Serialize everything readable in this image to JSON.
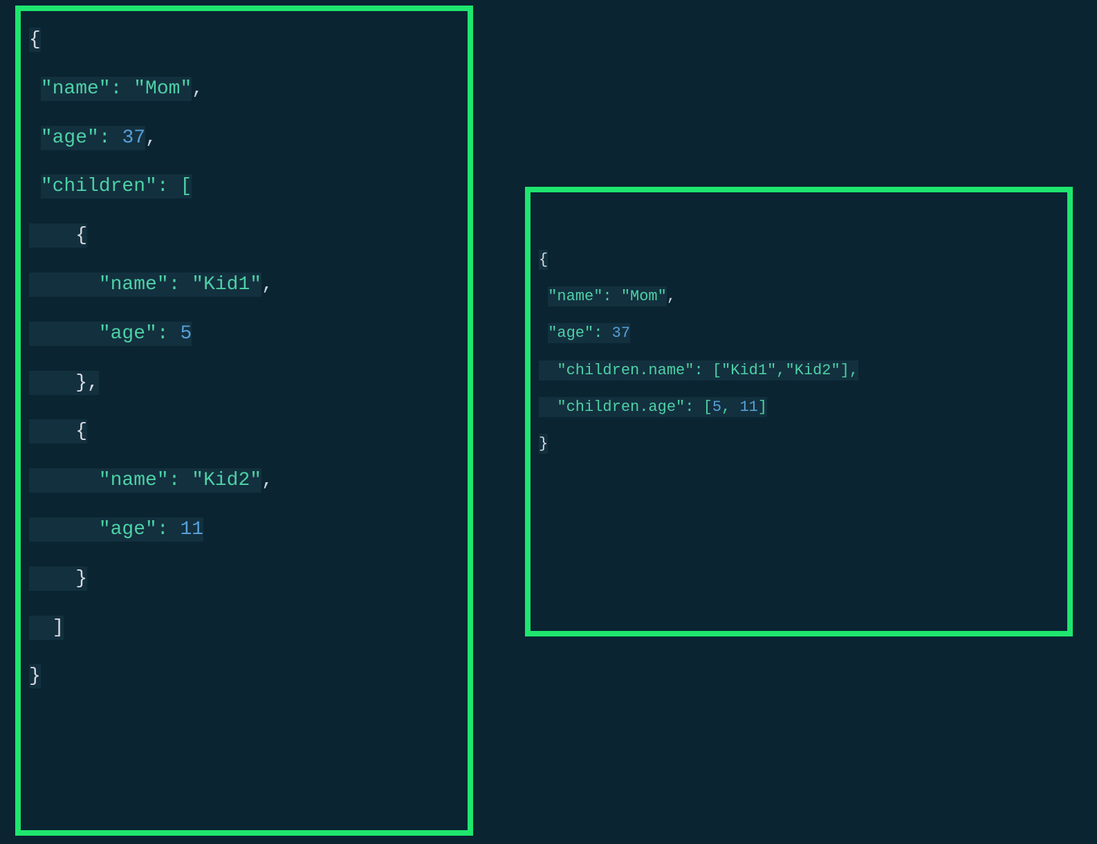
{
  "left": {
    "l1": "{",
    "l2_key": "\"name\"",
    "l2_colon": ": ",
    "l2_val": "\"Mom\"",
    "l2_comma": ",",
    "l3_key": "\"age\"",
    "l3_colon": ": ",
    "l3_val": "37",
    "l3_comma": ",",
    "l4_key": "\"children\"",
    "l4_colon": ": [",
    "l5": "    {",
    "l6_ind": "      ",
    "l6_key": "\"name\"",
    "l6_colon": ": ",
    "l6_val": "\"Kid1\"",
    "l6_comma": ",",
    "l7_ind": "      ",
    "l7_key": "\"age\"",
    "l7_colon": ": ",
    "l7_val": "5",
    "l8": "    },",
    "l9": "    {",
    "l10_ind": "      ",
    "l10_key": "\"name\"",
    "l10_colon": ": ",
    "l10_val": "\"Kid2\"",
    "l10_comma": ",",
    "l11_ind": "      ",
    "l11_key": "\"age\"",
    "l11_colon": ": ",
    "l11_val": "11",
    "l12": "    }",
    "l13": "  ]",
    "l14": "}"
  },
  "right": {
    "l1": "{",
    "l2_key": "\"name\"",
    "l2_colon": ": ",
    "l2_val": "\"Mom\"",
    "l2_comma": ",",
    "l3_key": "\"age\"",
    "l3_colon": ": ",
    "l3_val": "37",
    "l4_ind": "  ",
    "l4_key": "\"children.name\"",
    "l4_colon": ": [",
    "l4_v1": "\"Kid1\"",
    "l4_c1": ",",
    "l4_v2": "\"Kid2\"",
    "l4_close": "],",
    "l5_ind": "  ",
    "l5_key": "\"children.age\"",
    "l5_colon": ": [",
    "l5_v1": "5",
    "l5_c1": ", ",
    "l5_v2": "11",
    "l5_close": "]",
    "l6": "}"
  }
}
